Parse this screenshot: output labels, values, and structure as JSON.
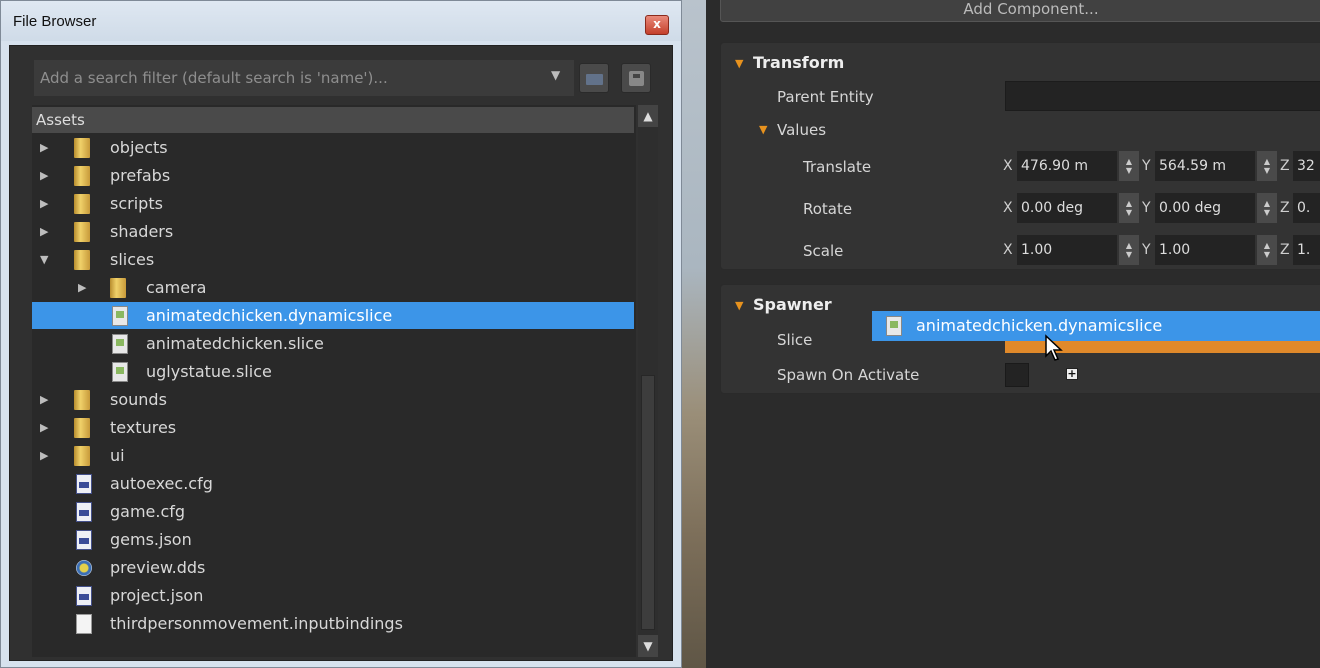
{
  "file_browser": {
    "title": "File Browser",
    "close_label": "x",
    "search_placeholder": "Add a search filter (default search is 'name')...",
    "tree_header": "Assets",
    "items": [
      {
        "label": "objects",
        "type": "folder",
        "expanded": false
      },
      {
        "label": "prefabs",
        "type": "folder",
        "expanded": false
      },
      {
        "label": "scripts",
        "type": "folder",
        "expanded": false
      },
      {
        "label": "shaders",
        "type": "folder",
        "expanded": false
      },
      {
        "label": "slices",
        "type": "folder",
        "expanded": true
      },
      {
        "label": "camera",
        "type": "folder",
        "expanded": false
      },
      {
        "label": "animatedchicken.dynamicslice",
        "type": "slice",
        "selected": true
      },
      {
        "label": "animatedchicken.slice",
        "type": "slice"
      },
      {
        "label": "uglystatue.slice",
        "type": "slice"
      },
      {
        "label": "sounds",
        "type": "folder",
        "expanded": false
      },
      {
        "label": "textures",
        "type": "folder",
        "expanded": false
      },
      {
        "label": "ui",
        "type": "folder",
        "expanded": false
      },
      {
        "label": "autoexec.cfg",
        "type": "cfg"
      },
      {
        "label": "game.cfg",
        "type": "cfg"
      },
      {
        "label": "gems.json",
        "type": "cfg"
      },
      {
        "label": "preview.dds",
        "type": "dds"
      },
      {
        "label": "project.json",
        "type": "cfg"
      },
      {
        "label": "thirdpersonmovement.inputbindings",
        "type": "file"
      }
    ]
  },
  "inspector": {
    "add_component": "Add Component...",
    "transform": {
      "title": "Transform",
      "parent_entity_label": "Parent Entity",
      "values_label": "Values",
      "rows": [
        {
          "label": "Translate",
          "x": "476.90 m",
          "y": "564.59 m",
          "z": "32"
        },
        {
          "label": "Rotate",
          "x": "0.00 deg",
          "y": "0.00 deg",
          "z": "0."
        },
        {
          "label": "Scale",
          "x": "1.00",
          "y": "1.00",
          "z": "1."
        }
      ],
      "axes": {
        "x": "X",
        "y": "Y",
        "z": "Z"
      }
    },
    "spawner": {
      "title": "Spawner",
      "slice_label": "Slice",
      "spawn_on_activate_label": "Spawn On Activate"
    },
    "drag_ghost_label": "animatedchicken.dynamicslice"
  },
  "colors": {
    "selection": "#3c95e8",
    "accent_orange": "#e7921e",
    "panel": "#2b2b2b"
  }
}
